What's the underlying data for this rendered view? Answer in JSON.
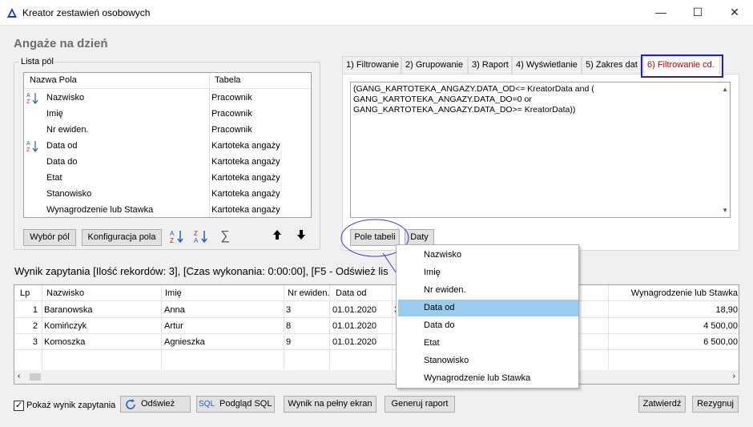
{
  "window": {
    "title": "Kreator zestawień osobowych",
    "minimize": "—",
    "maximize": "☐",
    "close": "✕"
  },
  "header": "Angaże na dzień",
  "fields_panel": {
    "group_label": "Lista pól",
    "columns": [
      "Nazwa Pola",
      "Tabela"
    ],
    "rows": [
      {
        "name": "Nazwisko",
        "table": "Pracownik",
        "sort": "asc"
      },
      {
        "name": "Imię",
        "table": "Pracownik",
        "sort": ""
      },
      {
        "name": "Nr ewiden.",
        "table": "Pracownik",
        "sort": ""
      },
      {
        "name": "Data od",
        "table": "Kartoteka angaży",
        "sort": "asc"
      },
      {
        "name": "Data do",
        "table": "Kartoteka angaży",
        "sort": ""
      },
      {
        "name": "Etat",
        "table": "Kartoteka angaży",
        "sort": ""
      },
      {
        "name": "Stanowisko",
        "table": "Kartoteka angaży",
        "sort": ""
      },
      {
        "name": "Wynagrodzenie lub Stawka",
        "table": "Kartoteka angaży",
        "sort": ""
      }
    ],
    "buttons": {
      "select_fields": "Wybór pól",
      "configure_field": "Konfiguracja pola",
      "sum": "∑"
    }
  },
  "tabs": [
    {
      "label": "1) Filtrowanie",
      "active": false
    },
    {
      "label": "2) Grupowanie",
      "active": false
    },
    {
      "label": "3) Raport",
      "active": false
    },
    {
      "label": "4) Wyświetlanie",
      "active": false
    },
    {
      "label": "5) Zakres dat",
      "active": false
    },
    {
      "label": "6) Filtrowanie cd.",
      "active": true
    }
  ],
  "sql_filter": "(GANG_KARTOTEKA_ANGAZY.DATA_OD<= KreatorData and (\nGANG_KARTOTEKA_ANGAZY.DATA_DO=0 or\nGANG_KARTOTEKA_ANGAZY.DATA_DO>= KreatorData))",
  "filter_buttons": {
    "table_fields": "Pole tabeli",
    "dates": "Daty"
  },
  "result": {
    "label": "Wynik zapytania [Ilość rekordów: 3], [Czas wykonania:  0:00:00], [F5 - Odśwież lis",
    "columns": [
      "Lp",
      "Nazwisko",
      "Imię",
      "Nr ewiden.",
      "Data od",
      "Wynagrodzenie lub Stawka"
    ],
    "rows": [
      {
        "lp": "1",
        "nazwisko": "Baranowska",
        "imie": "Anna",
        "nr": "3",
        "data_od": "01.01.2020",
        "extra": "3",
        "wynagrodzenie": "18,90"
      },
      {
        "lp": "2",
        "nazwisko": "Komińczyk",
        "imie": "Artur",
        "nr": "8",
        "data_od": "01.01.2020",
        "extra": "",
        "wynagrodzenie": "4 500,00"
      },
      {
        "lp": "3",
        "nazwisko": "Komoszka",
        "imie": "Agnieszka",
        "nr": "9",
        "data_od": "01.01.2020",
        "extra": "",
        "wynagrodzenie": "6 500,00"
      }
    ]
  },
  "dropdown": {
    "items": [
      "Nazwisko",
      "Imię",
      "Nr ewiden.",
      "Data od",
      "Data do",
      "Etat",
      "Stanowisko",
      "Wynagrodzenie lub Stawka"
    ],
    "selected": "Data od"
  },
  "bottom": {
    "show_result_label": "Pokaż wynik zapytania",
    "show_result_checked": true,
    "refresh": "Odśwież",
    "sql_icon_text": "SQL",
    "sql_preview": "Podgląd SQL",
    "fullscreen": "Wynik na pełny ekran",
    "generate_report": "Generuj raport",
    "confirm": "Zatwierdź",
    "cancel": "Rezygnuj"
  },
  "colors": {
    "active_tab_text": "#c00000",
    "highlight_border": "#1e1ecc",
    "selected_item": "#99ccee",
    "sort_icon_blue": "#2060c0",
    "sort_icon_red": "#c02020"
  }
}
